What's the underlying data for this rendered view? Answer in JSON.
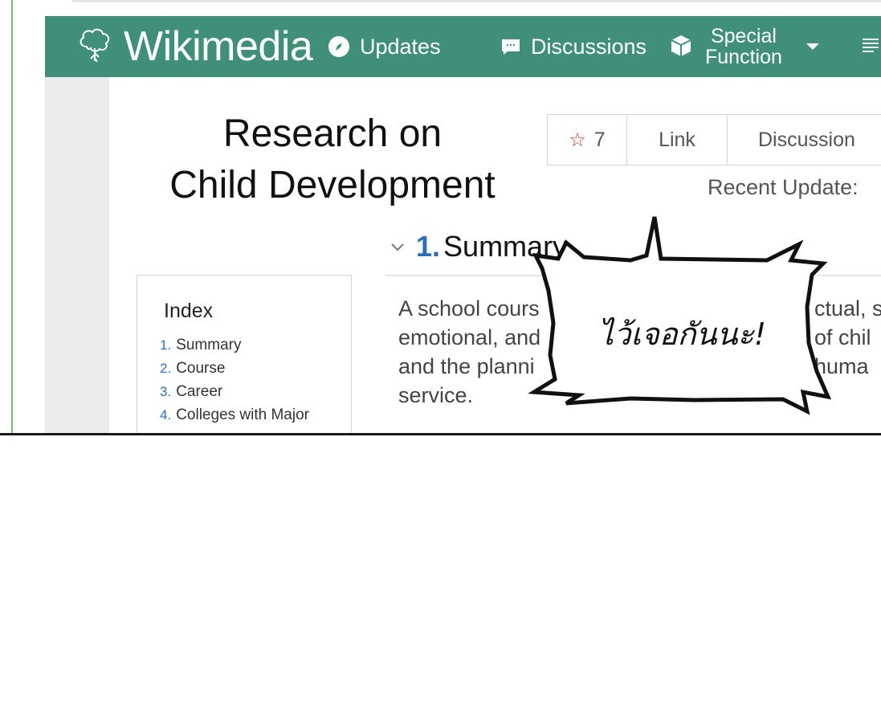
{
  "app": {
    "brand": "Wikimedia",
    "brand_color": "#3f8f79",
    "accent_color": "#2d6fb7"
  },
  "nav": {
    "updates_label": "Updates",
    "discussions_label": "Discussions",
    "special_label_line1": "Special",
    "special_label_line2": "Function",
    "icons": [
      "compass-icon",
      "speech-icon",
      "cube-icon",
      "chevron-down-icon",
      "menu-icon"
    ]
  },
  "article": {
    "title_line1": "Research on",
    "title_line2": "Child Development",
    "star_count": "7",
    "link_label": "Link",
    "discussion_label": "Discussion",
    "recent_update_label": "Recent Update:"
  },
  "section": {
    "number": "1.",
    "title": "Summary",
    "text_lines": [
      "A school cours",
      "emotional, and",
      "and the planni",
      "service."
    ],
    "text_right_lines": [
      "ctual, s",
      "of chil",
      "huma"
    ]
  },
  "index": {
    "title": "Index",
    "items": [
      {
        "num": "1.",
        "label": "Summary"
      },
      {
        "num": "2.",
        "label": "Course"
      },
      {
        "num": "3.",
        "label": "Career"
      },
      {
        "num": "4.",
        "label": "Colleges with Major"
      }
    ]
  },
  "bubble": {
    "text": "ไว้เจอกันนะ!"
  }
}
